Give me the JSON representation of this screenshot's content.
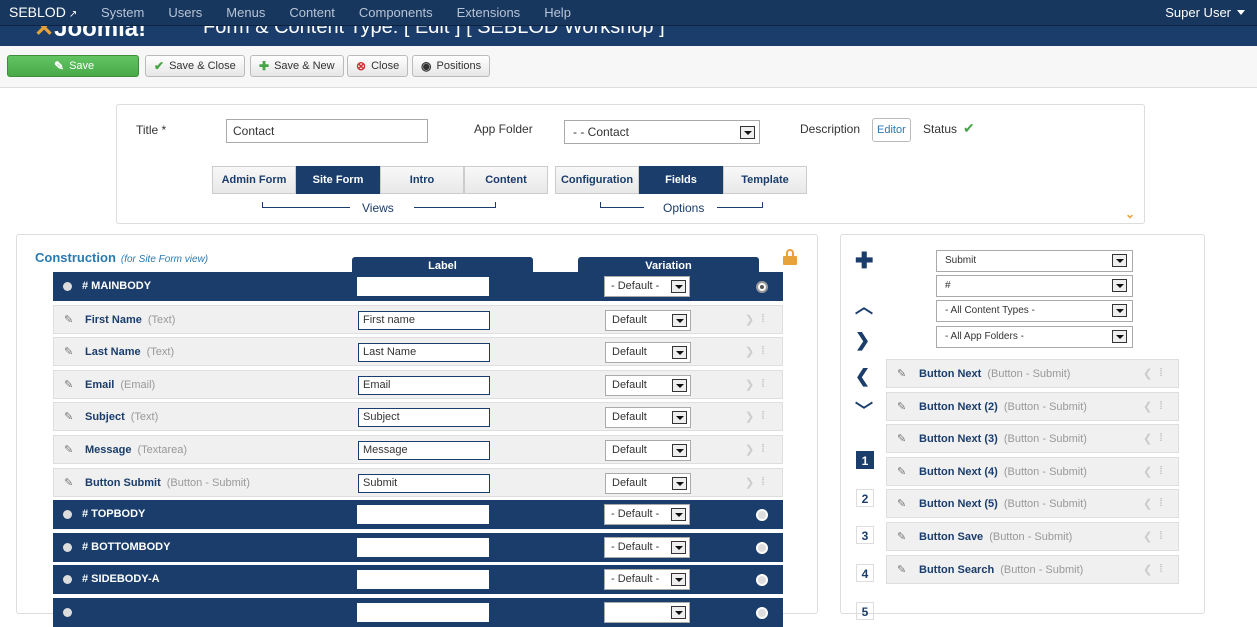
{
  "topnav": {
    "brand": "SEBLOD",
    "menu": [
      "System",
      "Users",
      "Menus",
      "Content",
      "Components",
      "Extensions",
      "Help"
    ],
    "user": "Super User"
  },
  "header": {
    "logo": "Joomla!",
    "title": "Form & Content Type: [ Edit ] [ SEBLOD Workshop ]"
  },
  "toolbar": {
    "save": "Save",
    "save_close": "Save & Close",
    "save_new": "Save & New",
    "close": "Close",
    "positions": "Positions"
  },
  "form": {
    "title_label": "Title *",
    "title_value": "Contact",
    "app_folder_label": "App Folder",
    "app_folder_value": "- - Contact",
    "description_label": "Description",
    "editor_button": "Editor",
    "status_label": "Status"
  },
  "views": {
    "group_label": "Views",
    "tabs": [
      "Admin Form",
      "Site Form",
      "Intro",
      "Content"
    ],
    "active": "Site Form"
  },
  "options": {
    "group_label": "Options",
    "tabs": [
      "Configuration",
      "Fields",
      "Template"
    ],
    "active": "Fields"
  },
  "construction": {
    "title": "Construction",
    "subtitle": "(for Site Form view)",
    "col_label": "Label",
    "col_variation": "Variation",
    "rows": [
      {
        "kind": "position",
        "name": "# MAINBODY",
        "label": "",
        "variation": "- Default -",
        "selected": true
      },
      {
        "kind": "field",
        "name": "First Name",
        "type": "(Text)",
        "label": "First name",
        "variation": "Default"
      },
      {
        "kind": "field",
        "name": "Last Name",
        "type": "(Text)",
        "label": "Last Name",
        "variation": "Default"
      },
      {
        "kind": "field",
        "name": "Email",
        "type": "(Email)",
        "label": "Email",
        "variation": "Default"
      },
      {
        "kind": "field",
        "name": "Subject",
        "type": "(Text)",
        "label": "Subject",
        "variation": "Default"
      },
      {
        "kind": "field",
        "name": "Message",
        "type": "(Textarea)",
        "label": "Message",
        "variation": "Default"
      },
      {
        "kind": "field",
        "name": "Button Submit",
        "type": "(Button - Submit)",
        "label": "Submit",
        "variation": "Default"
      },
      {
        "kind": "position",
        "name": "# TOPBODY",
        "label": "",
        "variation": "- Default -",
        "selected": false
      },
      {
        "kind": "position",
        "name": "# BOTTOMBODY",
        "label": "",
        "variation": "- Default -",
        "selected": false
      },
      {
        "kind": "position",
        "name": "# SIDEBODY-A",
        "label": "",
        "variation": "- Default -",
        "selected": false
      },
      {
        "kind": "position",
        "name": "",
        "label": "",
        "variation": "",
        "selected": false
      }
    ]
  },
  "library": {
    "filters": [
      "Submit",
      "#",
      "- All Content Types -",
      "- All App Folders -"
    ],
    "pages": [
      "1",
      "2",
      "3",
      "4",
      "5"
    ],
    "active_page": "1",
    "items": [
      {
        "name": "Button Next",
        "type": "(Button - Submit)"
      },
      {
        "name": "Button Next (2)",
        "type": "(Button - Submit)"
      },
      {
        "name": "Button Next (3)",
        "type": "(Button - Submit)"
      },
      {
        "name": "Button Next (4)",
        "type": "(Button - Submit)"
      },
      {
        "name": "Button Next (5)",
        "type": "(Button - Submit)"
      },
      {
        "name": "Button Save",
        "type": "(Button - Submit)"
      },
      {
        "name": "Button Search",
        "type": "(Button - Submit)"
      }
    ]
  },
  "colors": {
    "navy": "#1a3d6b",
    "green": "#5bb75b",
    "accent": "#e8a23a",
    "link": "#2a7ab0"
  }
}
